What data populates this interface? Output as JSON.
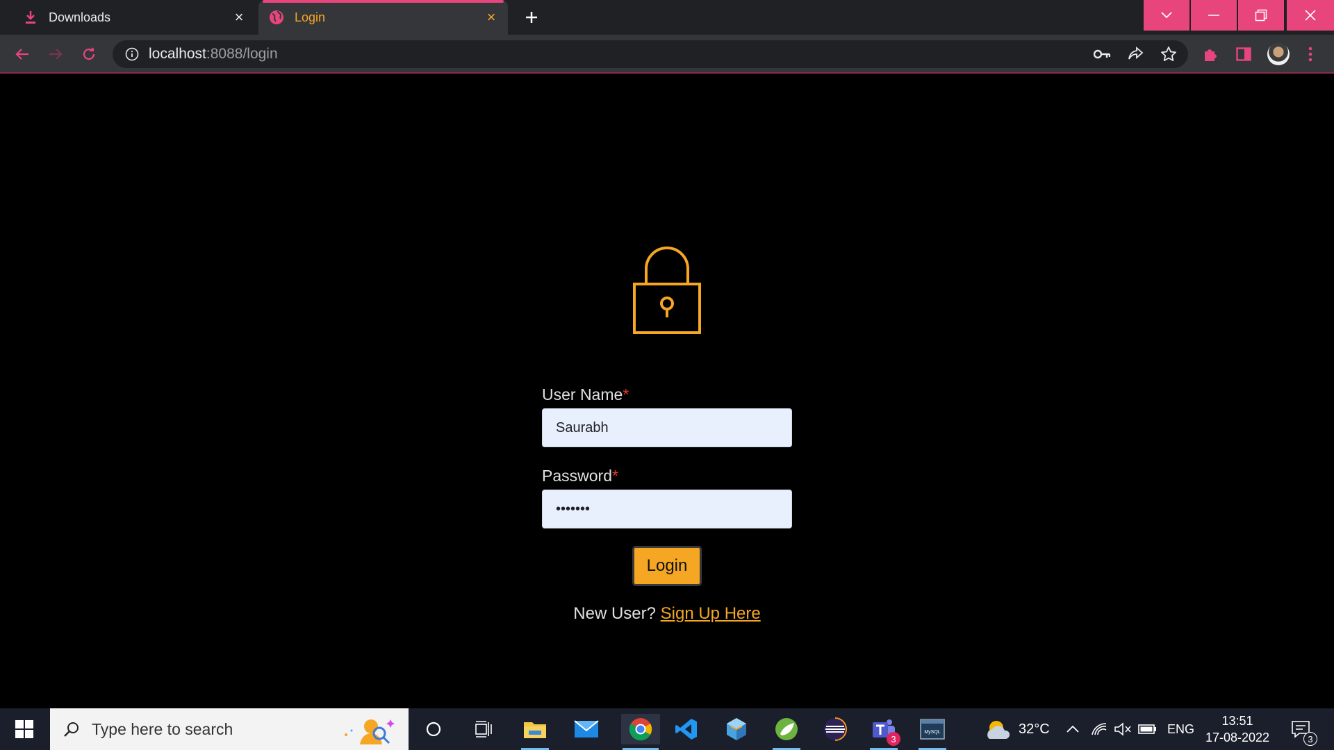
{
  "browser": {
    "tabs": [
      {
        "title": "Downloads",
        "icon": "download-icon",
        "active": false
      },
      {
        "title": "Login",
        "icon": "globe-icon",
        "active": true
      }
    ],
    "new_tab_symbol": "+",
    "close_symbol": "×",
    "url_host": "localhost",
    "url_rest": ":8088/login",
    "accent_color": "#e8457c"
  },
  "login": {
    "lock_icon": "padlock-icon",
    "username_label": "User Name",
    "password_label": "Password",
    "required_mark": "*",
    "username_value": "Saurabh",
    "password_value": "•••••••",
    "button_label": "Login",
    "new_user_text": "New User?",
    "signup_link": "Sign Up Here",
    "accent_color": "#f5a623"
  },
  "taskbar": {
    "search_placeholder": "Type here to search",
    "weather_temp": "32°C",
    "language": "ENG",
    "time": "13:51",
    "date": "17-08-2022",
    "teams_badge": "3",
    "notifications_badge": "3",
    "mysql_label": "MySQL"
  }
}
